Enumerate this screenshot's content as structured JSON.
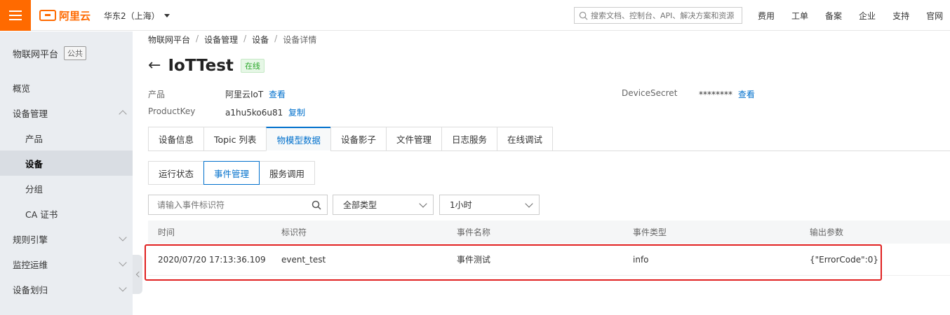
{
  "header": {
    "logo_text": "阿里云",
    "region": "华东2（上海）",
    "search_placeholder": "搜索文档、控制台、API、解决方案和资源",
    "nav": [
      "费用",
      "工单",
      "备案",
      "企业",
      "支持",
      "官网"
    ]
  },
  "sidebar": {
    "title": "物联网平台",
    "badge": "公共",
    "items": [
      {
        "label": "概览"
      },
      {
        "label": "设备管理"
      },
      {
        "label": "产品"
      },
      {
        "label": "设备"
      },
      {
        "label": "分组"
      },
      {
        "label": "CA 证书"
      },
      {
        "label": "规则引擎"
      },
      {
        "label": "监控运维"
      },
      {
        "label": "设备划归"
      }
    ]
  },
  "breadcrumb": [
    "物联网平台",
    "设备管理",
    "设备",
    "设备详情"
  ],
  "device": {
    "name": "IoTTest",
    "status": "在线",
    "product_key_label": "产品",
    "product_value": "阿里云IoT",
    "view_link": "查看",
    "pk_label": "ProductKey",
    "pk_value": "a1hu5ko6u81",
    "copy_link": "复制",
    "secret_label": "DeviceSecret",
    "secret_value": "********",
    "secret_link": "查看"
  },
  "tabs": [
    "设备信息",
    "Topic 列表",
    "物模型数据",
    "设备影子",
    "文件管理",
    "日志服务",
    "在线调试"
  ],
  "subtabs": [
    "运行状态",
    "事件管理",
    "服务调用"
  ],
  "filters": {
    "search_placeholder": "请输入事件标识符",
    "type_select": "全部类型",
    "time_select": "1小时"
  },
  "table": {
    "headers": [
      "时间",
      "标识符",
      "事件名称",
      "事件类型",
      "输出参数"
    ],
    "rows": [
      [
        "2020/07/20 17:13:36.109",
        "event_test",
        "事件测试",
        "info",
        "{\"ErrorCode\":0}"
      ]
    ]
  },
  "colors": {
    "brand": "#ff6a00",
    "link": "#0070cc",
    "online": "#2aa72a",
    "highlight": "#e02020"
  }
}
